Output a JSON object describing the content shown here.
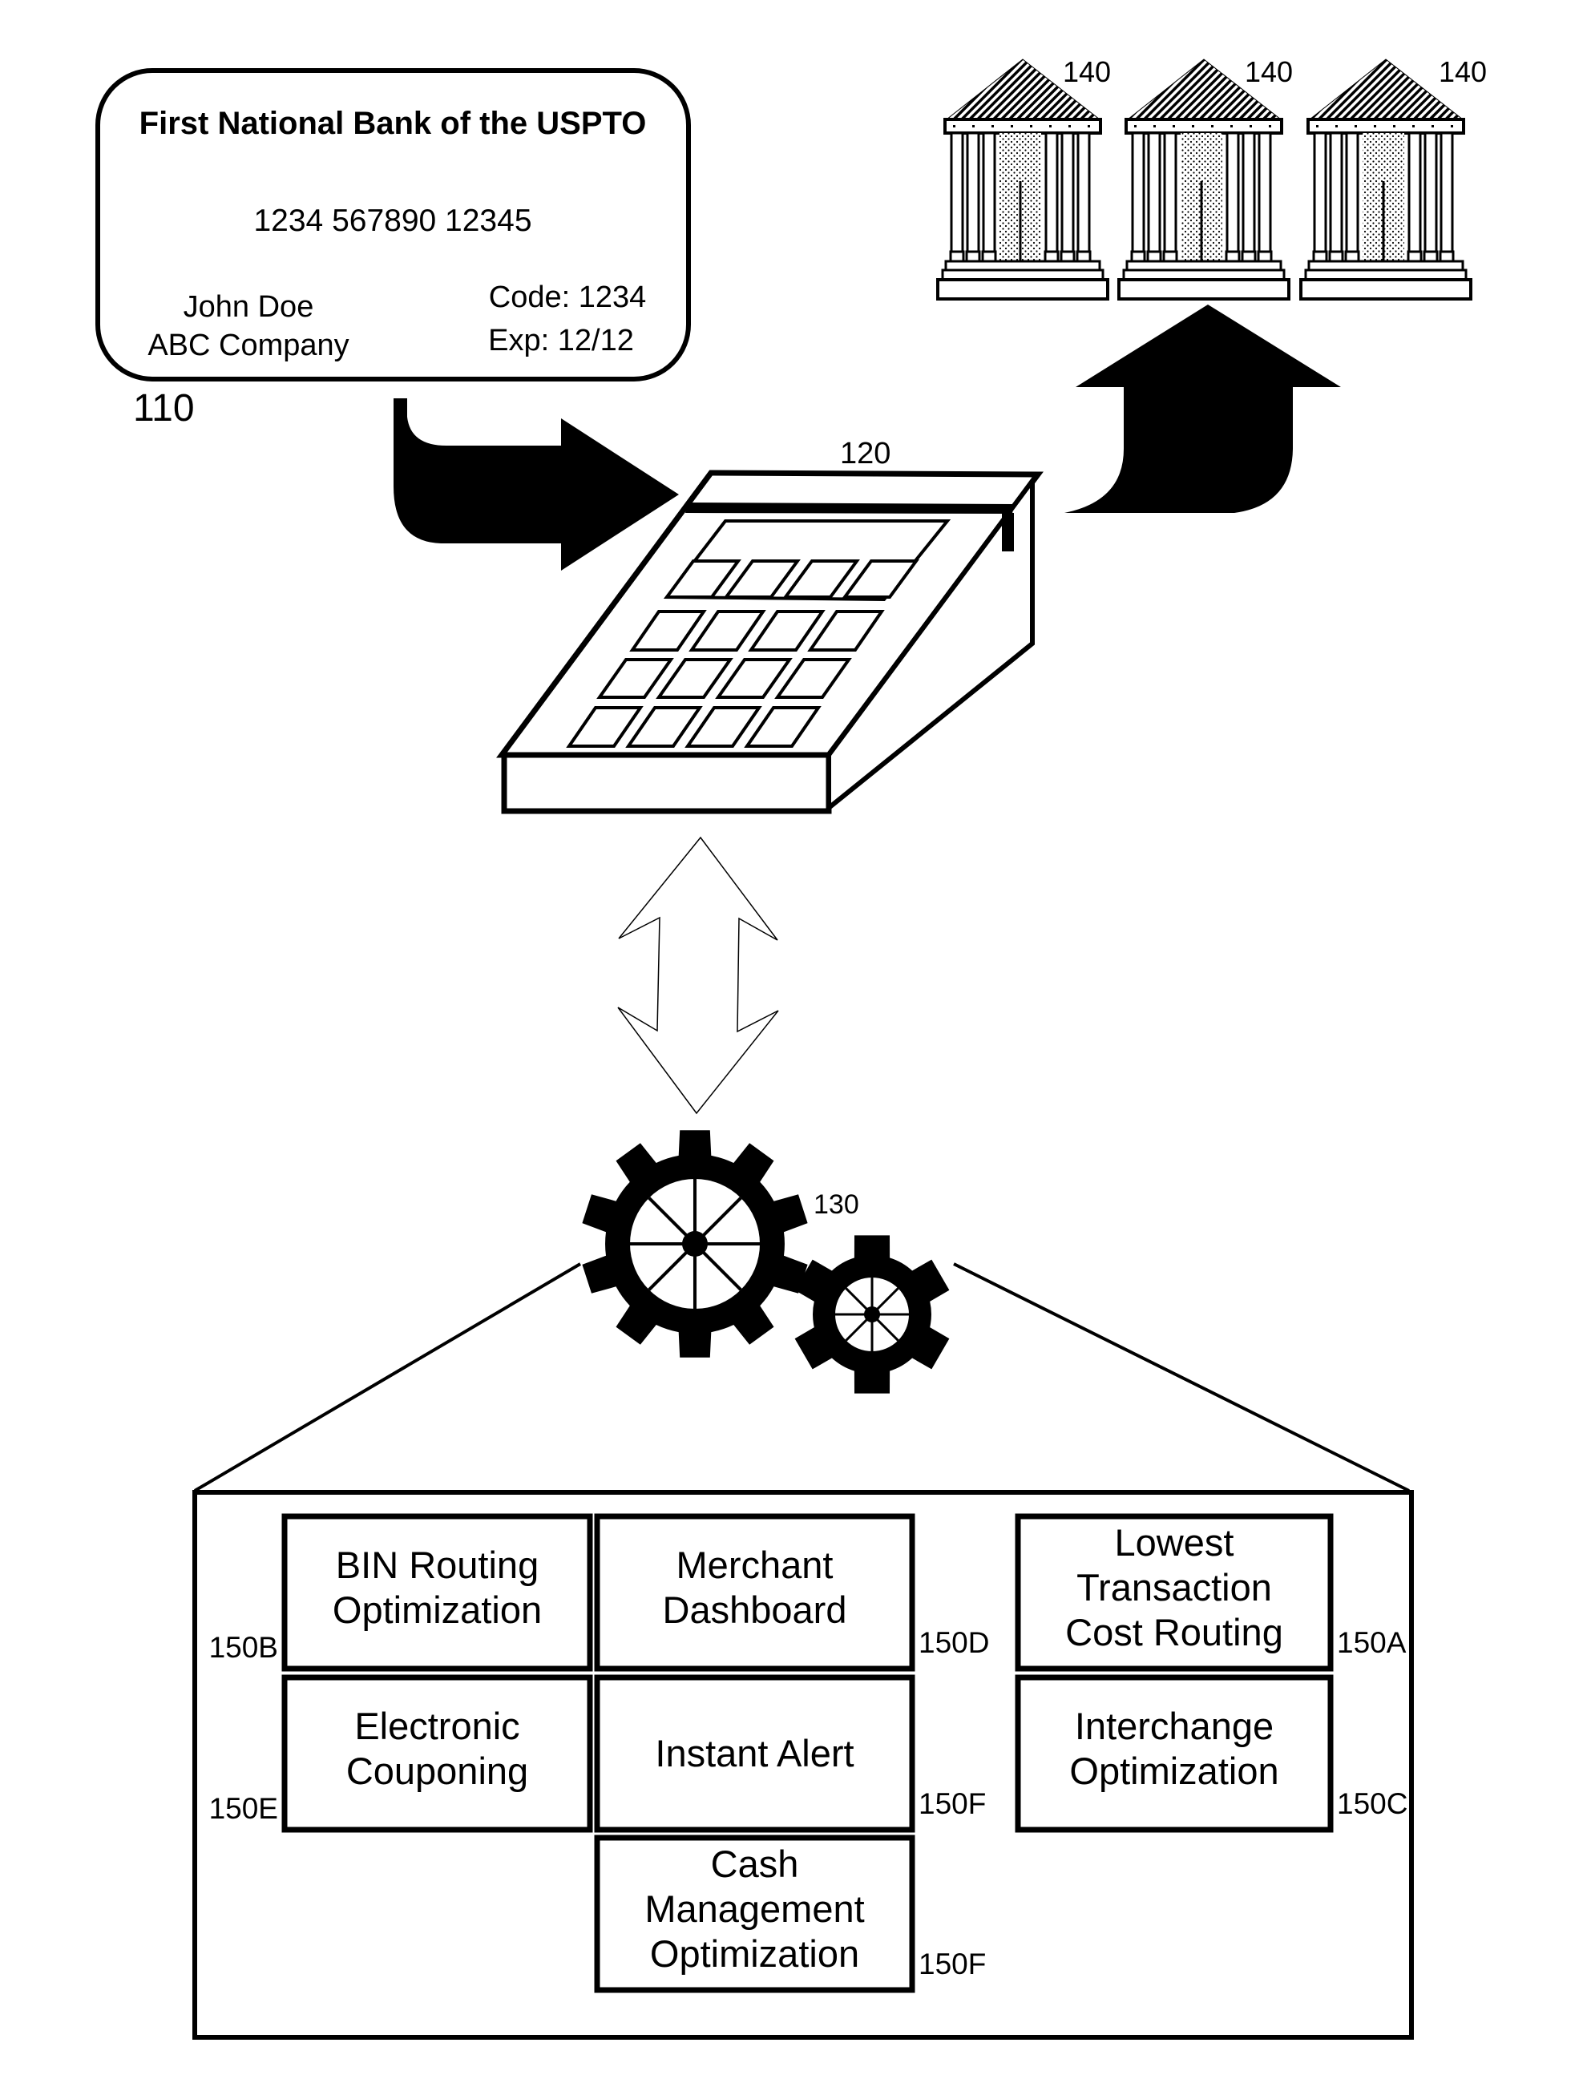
{
  "figure": {
    "card": {
      "ref": "110",
      "bank_name": "First National Bank of the USPTO",
      "card_number": "1234 567890 12345",
      "holder_name": "John Doe",
      "company": "ABC Company",
      "code": "Code: 1234",
      "expiry": "Exp: 12/12"
    },
    "terminal": {
      "ref": "120"
    },
    "banks": [
      {
        "ref": "140"
      },
      {
        "ref": "140"
      },
      {
        "ref": "140"
      }
    ],
    "processor": {
      "ref": "130"
    },
    "modules": [
      {
        "ref": "150B",
        "lines": [
          "BIN Routing",
          "Optimization"
        ]
      },
      {
        "ref": "150D",
        "lines": [
          "Merchant",
          "Dashboard"
        ]
      },
      {
        "ref": "150A",
        "lines": [
          "Lowest",
          "Transaction",
          "Cost Routing"
        ]
      },
      {
        "ref": "150E",
        "lines": [
          "Electronic",
          "Couponing"
        ]
      },
      {
        "ref": "150F",
        "lines": [
          "Instant Alert"
        ]
      },
      {
        "ref": "150C",
        "lines": [
          "Interchange",
          "Optimization"
        ]
      },
      {
        "ref": "150F",
        "lines": [
          "Cash",
          "Management",
          "Optimization"
        ]
      }
    ]
  }
}
